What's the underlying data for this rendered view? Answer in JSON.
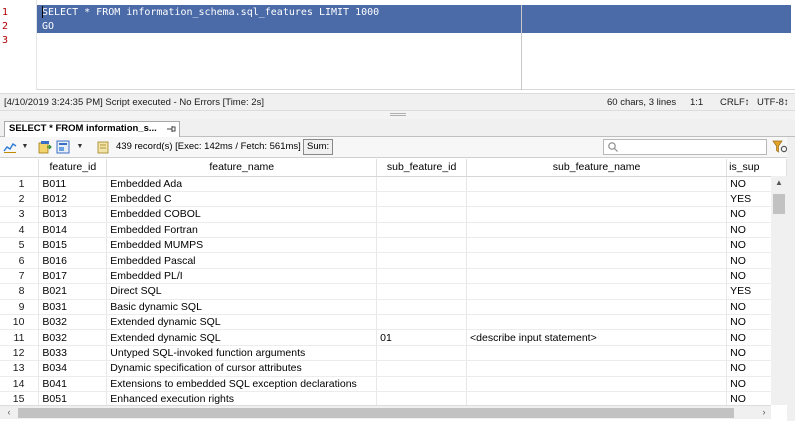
{
  "editor": {
    "line_numbers": [
      "1",
      "2",
      "3"
    ],
    "lines": [
      "SELECT * FROM information_schema.sql_features LIMIT 1000",
      "GO"
    ]
  },
  "statusbar": {
    "message": "[4/10/2019 3:24:35 PM] Script executed - No Errors [Time: 2s]",
    "chars_lines": "60 chars, 3 lines",
    "position": "1:1",
    "line_ending": "CRLF↕",
    "encoding": "UTF-8↕"
  },
  "result_tab": {
    "label": "SELECT * FROM information_s...",
    "pin_icon": "pin-icon"
  },
  "toolbar": {
    "records_text": "439 record(s) [Exec: 142ms / Fetch: 561ms]",
    "sum_label": "Sum:",
    "search_placeholder": "Q•"
  },
  "grid": {
    "columns": [
      "",
      "feature_id",
      "feature_name",
      "sub_feature_id",
      "sub_feature_name",
      "is_sup"
    ],
    "rows": [
      [
        "1",
        "B011",
        "Embedded Ada",
        "",
        "",
        "NO"
      ],
      [
        "2",
        "B012",
        "Embedded C",
        "",
        "",
        "YES"
      ],
      [
        "3",
        "B013",
        "Embedded COBOL",
        "",
        "",
        "NO"
      ],
      [
        "4",
        "B014",
        "Embedded Fortran",
        "",
        "",
        "NO"
      ],
      [
        "5",
        "B015",
        "Embedded MUMPS",
        "",
        "",
        "NO"
      ],
      [
        "6",
        "B016",
        "Embedded Pascal",
        "",
        "",
        "NO"
      ],
      [
        "7",
        "B017",
        "Embedded PL/I",
        "",
        "",
        "NO"
      ],
      [
        "8",
        "B021",
        "Direct SQL",
        "",
        "",
        "YES"
      ],
      [
        "9",
        "B031",
        "Basic dynamic SQL",
        "",
        "",
        "NO"
      ],
      [
        "10",
        "B032",
        "Extended dynamic SQL",
        "",
        "",
        "NO"
      ],
      [
        "11",
        "B032",
        "Extended dynamic SQL",
        "01",
        "<describe input statement>",
        "NO"
      ],
      [
        "12",
        "B033",
        "Untyped SQL-invoked function arguments",
        "",
        "",
        "NO"
      ],
      [
        "13",
        "B034",
        "Dynamic specification of cursor attributes",
        "",
        "",
        "NO"
      ],
      [
        "14",
        "B041",
        "Extensions to embedded SQL exception declarations",
        "",
        "",
        "NO"
      ],
      [
        "15",
        "B051",
        "Enhanced execution rights",
        "",
        "",
        "NO"
      ]
    ]
  },
  "colors": {
    "selection": "#4a6aa8",
    "line_number": "#b00000"
  }
}
